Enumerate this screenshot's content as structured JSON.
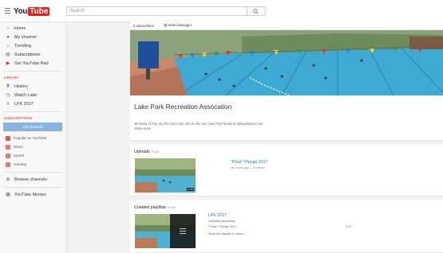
{
  "header": {
    "logo_you": "You",
    "logo_tube": "Tube",
    "search_placeholder": "Search"
  },
  "sidebar": {
    "items": [
      {
        "label": "Home",
        "icon": "home-icon",
        "glyph": "⌂"
      },
      {
        "label": "My channel",
        "icon": "person-icon",
        "glyph": "●"
      },
      {
        "label": "Trending",
        "icon": "flame-icon",
        "glyph": "♨"
      },
      {
        "label": "Subscriptions",
        "icon": "subscriptions-icon",
        "glyph": "▤"
      },
      {
        "label": "Get YouTube Red",
        "icon": "youtube-red-icon",
        "glyph": "▶"
      }
    ],
    "library_label": "LIBRARY",
    "library": [
      {
        "label": "History",
        "icon": "hourglass-icon",
        "glyph": "⧗"
      },
      {
        "label": "Watch Later",
        "icon": "clock-icon",
        "glyph": "◷"
      },
      {
        "label": "LPK 2017",
        "icon": "playlist-icon",
        "glyph": "≡"
      }
    ],
    "subscriptions_label": "SUBSCRIPTIONS",
    "add_channels": "Add channels",
    "subscriptions": [
      {
        "label": "Popular on YouTube",
        "color": "#e05656"
      },
      {
        "label": "Music",
        "color": "#e87575"
      },
      {
        "label": "Sports",
        "color": "#e87575"
      },
      {
        "label": "Gaming",
        "color": "#e87575"
      }
    ],
    "browse_channels": "Browse channels",
    "youtube_movies": "YouTube Movies"
  },
  "channel": {
    "subscribers": "0 subscribers",
    "video_manager": "Video Manager",
    "title": "Lake Park Recreation Assocation",
    "description": "48 Years of Fun at LPK! Get more info on the our Lake Park family at lakeparkpool.com",
    "show_more": "Show more"
  },
  "uploads": {
    "title": "Uploads",
    "privacy": "Public",
    "video_title": "\"Polar\" Plunge 2017",
    "video_meta": "16 hours ago  •  13 views",
    "duration": "0:40"
  },
  "playlists": {
    "title": "Created playlists",
    "privacy": "Public",
    "playlist_title": "LPK 2017",
    "updated": "Updated yesterday",
    "item_title": "\"Polar\" Plunge 2017",
    "item_duration": "0:40",
    "view_full": "View full playlist (1 video)"
  },
  "colors": {
    "brand_red": "#e62117",
    "link_blue": "#167ac6",
    "add_channels_blue": "#88b4e0"
  }
}
